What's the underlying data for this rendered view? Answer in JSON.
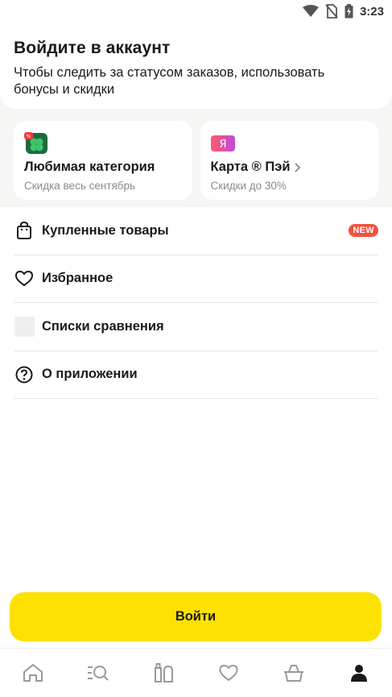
{
  "status_bar": {
    "time": "3:23",
    "icons": [
      "wifi-icon",
      "no-sim-icon",
      "battery-charging-icon"
    ]
  },
  "header": {
    "title": "Войдите в аккаунт",
    "subtitle": "Чтобы следить за статусом заказов, использовать бонусы и скидки"
  },
  "promos": [
    {
      "title": "Любимая категория",
      "subtitle": "Скидка весь сентябрь",
      "icon": "clover-percent-icon",
      "icon_colors": [
        "#1d6b3c",
        "#3ec46a",
        "#f23a3a"
      ]
    },
    {
      "title": "Карта ® Пэй",
      "subtitle": "Скидки до 30%",
      "icon": "yandex-pay-icon",
      "icon_text": "Я",
      "icon_colors": [
        "#ff5a6e",
        "#c04bd8"
      ]
    }
  ],
  "menu": {
    "items": [
      {
        "label": "Купленные товары",
        "icon": "shopping-bag-icon",
        "badge": "NEW"
      },
      {
        "label": "Избранное",
        "icon": "heart-icon"
      },
      {
        "label": "Списки сравнения",
        "icon": "compare-icon"
      },
      {
        "label": "О приложении",
        "icon": "help-icon"
      }
    ]
  },
  "login_button": {
    "label": "Войти"
  },
  "bottom_nav": {
    "items": [
      "home-icon",
      "catalog-search-icon",
      "products-icon",
      "favorites-icon",
      "cart-icon",
      "profile-icon"
    ],
    "active": "profile-icon"
  },
  "colors": {
    "accent_yellow": "#fde100",
    "badge_red": "#f5503d",
    "background": "#f6f6f4"
  }
}
